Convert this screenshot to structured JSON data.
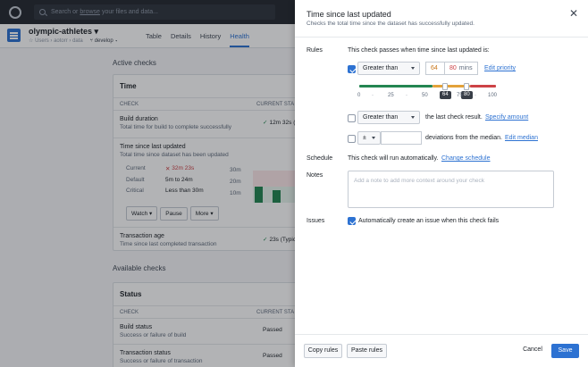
{
  "topbar": {
    "search_prefix": "Search or",
    "search_link": "browse",
    "search_suffix": "your files and data..."
  },
  "dataset": {
    "name": "olympic-athletes",
    "breadcrumb": "Users › aotorr › data",
    "branch": "develop"
  },
  "tabs": [
    "Table",
    "Details",
    "History",
    "Health"
  ],
  "active_tab": "Health",
  "background": {
    "active_checks_title": "Active checks",
    "time_card_title": "Time",
    "col_check": "CHECK",
    "col_status": "CURRENT STA",
    "rows": [
      {
        "name": "Build duration",
        "desc": "Total time for build to complete successfully",
        "status": "12m 32s (T"
      },
      {
        "name": "Time since last updated",
        "desc": "Total time since dataset has been updated"
      }
    ],
    "detail": {
      "current_label": "Current",
      "current_value": "32m 23s",
      "default_label": "Default",
      "default_value": "5m to 24m",
      "critical_label": "Critical",
      "critical_value": "Less than 30m",
      "axis": [
        "30m",
        "20m",
        "10m"
      ]
    },
    "actions": [
      "Watch",
      "Pause",
      "More"
    ],
    "transaction_age": {
      "name": "Transaction age",
      "desc": "Time since last completed transaction",
      "status": "23s (Typic"
    },
    "available_checks_title": "Available checks",
    "status_card_title": "Status",
    "status_rows": [
      {
        "name": "Build status",
        "desc": "Success or failure of build",
        "status": "Passed"
      },
      {
        "name": "Transaction status",
        "desc": "Success or failure of transaction",
        "status": "Passed"
      }
    ]
  },
  "drawer": {
    "title": "Time since last updated",
    "subtitle": "Checks the total time since the dataset has successfully updated.",
    "rules_label": "Rules",
    "rules_intro": "This check passes when time since last updated is:",
    "rule1": {
      "comparator": "Greater than",
      "warn_value": "64",
      "crit_value": "80",
      "unit": "mins",
      "link": "Edit priority"
    },
    "slider": {
      "ticks": [
        "0",
        "25",
        "50",
        "75",
        "100"
      ],
      "min": 0,
      "max": 100,
      "low_handle": 64,
      "high_handle": 80,
      "low_label": "64",
      "high_label": "80"
    },
    "rule2": {
      "comparator": "Greater than",
      "text": "the last check result.",
      "link": "Specify amount"
    },
    "rule3": {
      "symbol": "±",
      "text": "deviations from the median.",
      "link": "Edit median"
    },
    "schedule_label": "Schedule",
    "schedule_text": "This check will run automatically.",
    "schedule_link": "Change schedule",
    "notes_label": "Notes",
    "notes_placeholder": "Add a note to add more context around your check",
    "issues_label": "Issues",
    "issues_text": "Automatically create an issue when this check fails",
    "footer": {
      "copy": "Copy rules",
      "paste": "Paste rules",
      "cancel": "Cancel",
      "save": "Save"
    }
  },
  "colors": {
    "accent": "#2d72d2",
    "success": "#238551",
    "warning": "#c87619",
    "danger": "#cd4246"
  }
}
